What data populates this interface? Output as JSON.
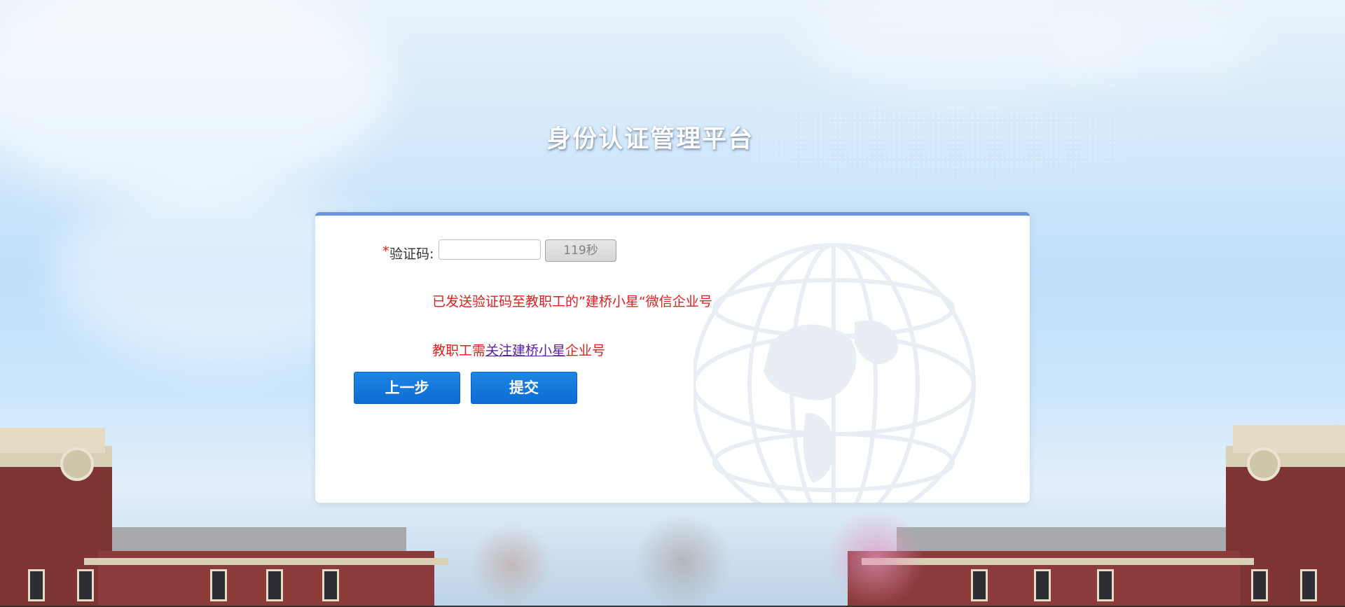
{
  "header": {
    "title": "身份认证管理平台"
  },
  "form": {
    "required_mark": "*",
    "code_label": "验证码:",
    "code_value": "",
    "countdown_label": "119秒",
    "message_sent": "已发送验证码至教职工的”建桥小星“微信企业号",
    "follow_prefix": "教职工需",
    "follow_link": "关注建桥小星",
    "follow_suffix": "企业号",
    "prev_button": "上一步",
    "submit_button": "提交"
  },
  "colors": {
    "accent": "#1877da",
    "error_text": "#e31c1c",
    "link": "#5a1fa0",
    "card_border": "#6a93e6"
  },
  "icons": {
    "background": "globe-watermark-icon"
  }
}
